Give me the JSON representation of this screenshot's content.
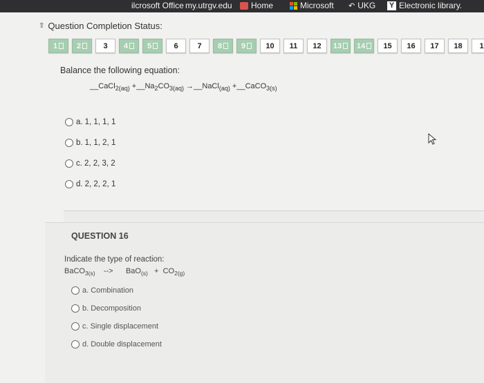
{
  "bookmarks": {
    "partial_left": "ilcrosoft Office",
    "partial_center": "my.utrgv.edu",
    "items": [
      {
        "label": "Home",
        "icon": "home-icon"
      },
      {
        "label": "Microsoft",
        "icon": "microsoft-icon"
      },
      {
        "label": "UKG",
        "icon": "ukg-icon"
      },
      {
        "label": "Electronic library.",
        "icon": "y-icon"
      }
    ]
  },
  "status": {
    "title": "Question Completion Status:",
    "questions": [
      {
        "label": "1",
        "done": true
      },
      {
        "label": "2",
        "done": true
      },
      {
        "label": "3",
        "done": false
      },
      {
        "label": "4",
        "done": true
      },
      {
        "label": "5",
        "done": true
      },
      {
        "label": "6",
        "done": false
      },
      {
        "label": "7",
        "done": false
      },
      {
        "label": "8",
        "done": true
      },
      {
        "label": "9",
        "done": true
      },
      {
        "label": "10",
        "done": false
      },
      {
        "label": "11",
        "done": false
      },
      {
        "label": "12",
        "done": false
      },
      {
        "label": "13",
        "done": true
      },
      {
        "label": "14",
        "done": true
      },
      {
        "label": "15",
        "done": false
      },
      {
        "label": "16",
        "done": false
      },
      {
        "label": "17",
        "done": false
      },
      {
        "label": "18",
        "done": false
      },
      {
        "label": "1",
        "done": false
      }
    ]
  },
  "q15": {
    "prompt": "Balance the following equation:",
    "equation": {
      "blank": "__",
      "r1": "CaCl",
      "r1_sub": "2(aq)",
      "plus": "+",
      "r2a": "Na",
      "r2a_sub": "2",
      "r2b": "CO",
      "r2b_sub": "3(aq)",
      "arrow": "→",
      "p1": "NaCl",
      "p1_sub": "(aq)",
      "p2": "CaCO",
      "p2_sub": "3(s)"
    },
    "options": [
      {
        "letter": "a.",
        "text": "1, 1, 1, 1"
      },
      {
        "letter": "b.",
        "text": "1, 1, 2, 1"
      },
      {
        "letter": "c.",
        "text": "2, 2, 3, 2"
      },
      {
        "letter": "d.",
        "text": "2, 2, 2, 1"
      }
    ]
  },
  "q16": {
    "title": "QUESTION 16",
    "prompt": "Indicate the type of reaction:",
    "reaction": {
      "r1": "BaCO",
      "r1_sub": "3(s)",
      "arrow": "-->",
      "p1": "BaO",
      "p1_sub": "(s)",
      "plus": "+",
      "p2": "CO",
      "p2_sub": "2(g)"
    },
    "options": [
      {
        "letter": "a.",
        "text": "Combination"
      },
      {
        "letter": "b.",
        "text": "Decomposition"
      },
      {
        "letter": "c.",
        "text": "Single displacement"
      },
      {
        "letter": "d.",
        "text": "Double displacement"
      }
    ]
  },
  "colors": {
    "completed": "#a6ceb1",
    "page_bg": "#f1f1ef",
    "toolbar_bg": "#2f2f31"
  }
}
